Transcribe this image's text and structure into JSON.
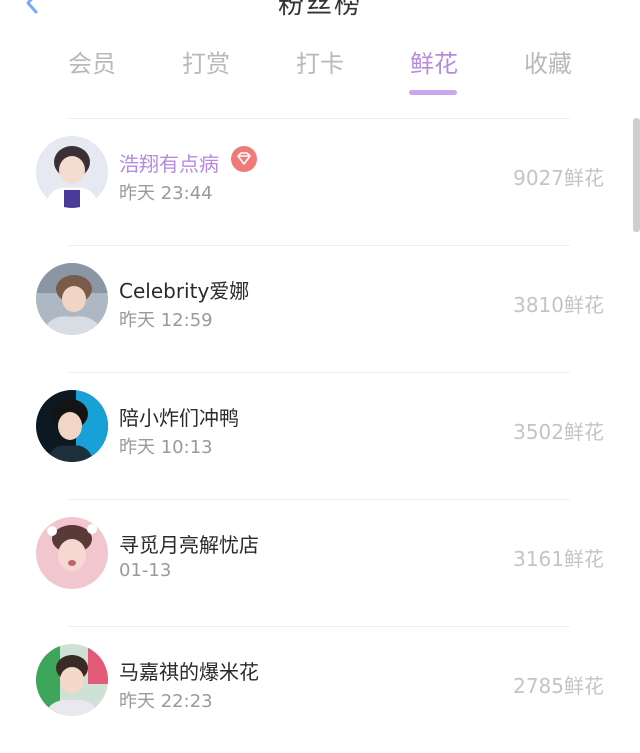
{
  "header": {
    "title": "粉丝榜",
    "back_icon": "chevron-left-icon"
  },
  "tabs": [
    {
      "label": "会员",
      "active": false
    },
    {
      "label": "打赏",
      "active": false
    },
    {
      "label": "打卡",
      "active": false
    },
    {
      "label": "鲜花",
      "active": true
    },
    {
      "label": "收藏",
      "active": false
    }
  ],
  "colors": {
    "accent": "#b58be0",
    "badge": "#f07a7a"
  },
  "list": [
    {
      "name": "浩翔有点病",
      "time": "昨天 23:44",
      "count": "9027鲜花",
      "vip": true,
      "badge_icon": "diamond-icon"
    },
    {
      "name": "Celebrity爱娜",
      "time": "昨天 12:59",
      "count": "3810鲜花",
      "vip": false
    },
    {
      "name": "陪小炸们冲鸭",
      "time": "昨天 10:13",
      "count": "3502鲜花",
      "vip": false
    },
    {
      "name": "寻觅月亮解忧店",
      "time": "01-13",
      "count": "3161鲜花",
      "vip": false
    },
    {
      "name": "马嘉祺的爆米花",
      "time": "昨天 22:23",
      "count": "2785鲜花",
      "vip": false
    }
  ]
}
